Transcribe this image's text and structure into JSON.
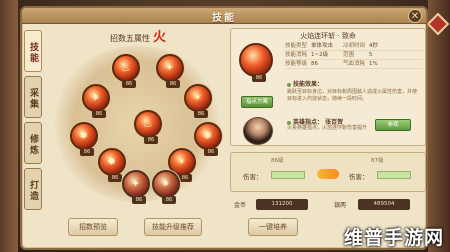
{
  "window": {
    "title": "技能",
    "close_glyph": "✕"
  },
  "tabs": [
    {
      "label": "技能",
      "active": true
    },
    {
      "label": "采集",
      "active": false
    },
    {
      "label": "修炼",
      "active": false
    },
    {
      "label": "打造",
      "active": false
    }
  ],
  "element": {
    "label": "招数五属性",
    "value": "火"
  },
  "skills": [
    {
      "lv": "86"
    },
    {
      "lv": "86"
    },
    {
      "lv": "86"
    },
    {
      "lv": "86"
    },
    {
      "lv": "86"
    },
    {
      "lv": "86"
    },
    {
      "lv": "86"
    },
    {
      "lv": "86"
    },
    {
      "lv": "86"
    },
    {
      "lv": "86"
    },
    {
      "lv": "86"
    },
    {
      "lv": "86"
    }
  ],
  "bottom_buttons": [
    "招数预览",
    "技能升级推荐",
    "一键培养"
  ],
  "detail": {
    "title": "火焰连环斩 · 致命",
    "skill_lv": "86",
    "stats": [
      {
        "k": "技能类型",
        "v": "单体攻击",
        "k2": "冷却时间",
        "v2": "4秒"
      },
      {
        "k": "技能消耗",
        "v": "1~2级",
        "k2": "范围",
        "v2": "5"
      },
      {
        "k": "技能等级",
        "v": "86",
        "k2": "气血消耗",
        "v2": "1%"
      }
    ],
    "effect_label": "技能效果：",
    "effect_text": "跳跃至目标身边，对目标和周围敌人造成火属性伤害，并使目标进入灼烧状态，持续一段时间。",
    "upgrade_button": "指点方案",
    "hero_label": "英雄指点：",
    "hero_name": "张百贺",
    "hero_text": "火系英雄指点，火焰连环斩伤害提升",
    "hero_button": "参观"
  },
  "compare": {
    "left_head": "86级",
    "right_head": "87级",
    "left_label": "伤害：",
    "right_label": "伤害："
  },
  "currency": {
    "label1": "金币",
    "value1": "131200",
    "label2": "银两",
    "value2": "489504"
  },
  "watermark": "维普手游网"
}
